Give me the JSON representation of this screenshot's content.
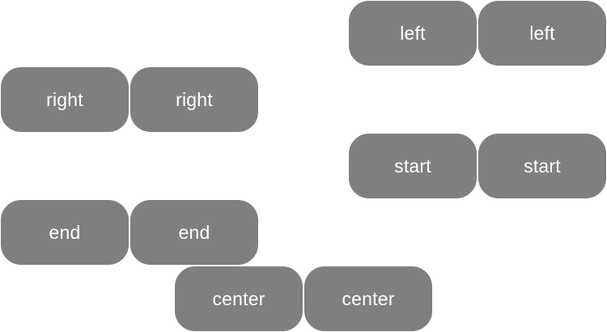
{
  "colors": {
    "pill_fill": "#7f7f7f",
    "pill_text": "#ffffff",
    "background": "#ffffff"
  },
  "rows": [
    {
      "alignment": "left",
      "buttons": [
        "left",
        "left"
      ]
    },
    {
      "alignment": "right",
      "buttons": [
        "right",
        "right"
      ]
    },
    {
      "alignment": "start",
      "buttons": [
        "start",
        "start"
      ]
    },
    {
      "alignment": "end",
      "buttons": [
        "end",
        "end"
      ]
    },
    {
      "alignment": "center",
      "buttons": [
        "center",
        "center"
      ]
    }
  ]
}
